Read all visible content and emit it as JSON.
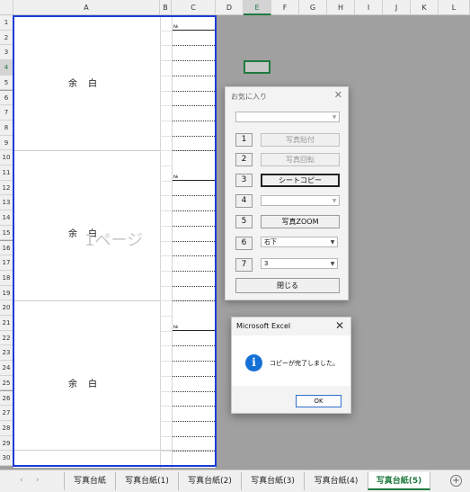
{
  "columns": [
    "A",
    "B",
    "C",
    "D",
    "E",
    "F",
    "G",
    "H",
    "I",
    "J",
    "K",
    "L"
  ],
  "rows": [
    "1",
    "2",
    "3",
    "4",
    "5",
    "6",
    "7",
    "8",
    "9",
    "10",
    "11",
    "12",
    "13",
    "14",
    "15",
    "16",
    "17",
    "18",
    "19",
    "20",
    "21",
    "22",
    "23",
    "24",
    "25",
    "26",
    "27",
    "28",
    "29",
    "30"
  ],
  "sheet": {
    "margin_label": "余白",
    "no_label": "№",
    "page_watermark": "1ページ"
  },
  "favorites_dialog": {
    "title": "お気に入り",
    "close_icon": "close-icon",
    "top_combo_value": "",
    "buttons": [
      {
        "num": "1",
        "label": "写真貼付",
        "enabled": false
      },
      {
        "num": "2",
        "label": "写真回転",
        "enabled": false
      },
      {
        "num": "3",
        "label": "シートコピー",
        "enabled": true
      },
      {
        "num": "4",
        "label": "",
        "enabled": false
      },
      {
        "num": "5",
        "label": "写真ZOOM",
        "enabled": true
      },
      {
        "num": "6",
        "label": "右下",
        "enabled": true
      },
      {
        "num": "7",
        "label": "3",
        "enabled": true
      }
    ],
    "close_button": "閉じる"
  },
  "message_box": {
    "title": "Microsoft Excel",
    "icon": "info-icon",
    "message": "コピーが完了しました。",
    "ok_label": "OK"
  },
  "tabs": {
    "items": [
      "写真台紙",
      "写真台紙(1)",
      "写真台紙(2)",
      "写真台紙(3)",
      "写真台紙(4)",
      "写真台紙(5)"
    ],
    "active": "写真台紙(5)",
    "add_icon": "plus-icon"
  },
  "colors": {
    "accent_green": "#1f7a3f",
    "page_border_blue": "#1a3bd8",
    "info_blue": "#1570d6"
  }
}
